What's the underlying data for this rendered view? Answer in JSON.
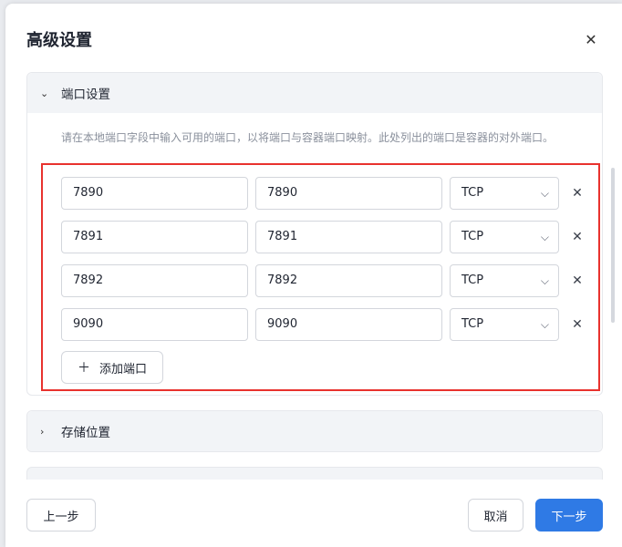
{
  "dialog": {
    "title": "高级设置",
    "close_icon": "close-icon"
  },
  "port_section": {
    "title": "端口设置",
    "expanded": true,
    "hint": "请在本地端口字段中输入可用的端口，以将端口与容器端口映射。此处列出的端口是容器的对外端口。",
    "rows": [
      {
        "local": "7890",
        "container": "7890",
        "protocol": "TCP"
      },
      {
        "local": "7891",
        "container": "7891",
        "protocol": "TCP"
      },
      {
        "local": "7892",
        "container": "7892",
        "protocol": "TCP"
      },
      {
        "local": "9090",
        "container": "9090",
        "protocol": "TCP"
      }
    ],
    "add_label": "添加端口",
    "highlight_color": "#e8322e"
  },
  "storage_section": {
    "title": "存储位置",
    "expanded": false
  },
  "footer": {
    "prev_label": "上一步",
    "cancel_label": "取消",
    "next_label": "下一步"
  },
  "colors": {
    "primary": "#2f7ae5"
  }
}
